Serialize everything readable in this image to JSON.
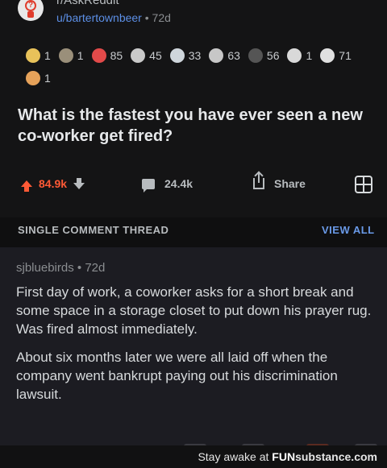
{
  "header": {
    "subreddit": "r/AskReddit",
    "user": "u/bartertownbeer",
    "separator": " • ",
    "age": "72d"
  },
  "awards": [
    {
      "icon": "gold-award-icon",
      "color": "#e8c25a",
      "count": "1"
    },
    {
      "icon": "wholesome-award-icon",
      "color": "#9a8f7a",
      "count": "1"
    },
    {
      "icon": "heart-award-icon",
      "color": "#e24a4a",
      "count": "85"
    },
    {
      "icon": "helpful-award-icon",
      "color": "#c9c9c9",
      "count": "45"
    },
    {
      "icon": "silver-award-icon",
      "color": "#cfd6dc",
      "count": "33"
    },
    {
      "icon": "coin-award-icon",
      "color": "#c7c7c7",
      "count": "63"
    },
    {
      "icon": "badge-award-icon",
      "color": "#555555",
      "count": "56"
    },
    {
      "icon": "face-award-icon",
      "color": "#d9d9d9",
      "count": "1"
    },
    {
      "icon": "bear-award-icon",
      "color": "#e0e0e0",
      "count": "71"
    },
    {
      "icon": "star-award-icon",
      "color": "#e6a25a",
      "count": "1"
    }
  ],
  "post": {
    "title": "What is the fastest you have ever seen a new co-worker get fired?"
  },
  "actions": {
    "votes": "84.9k",
    "comments": "24.4k",
    "share": "Share"
  },
  "thread": {
    "label": "SINGLE COMMENT THREAD",
    "view_all": "VIEW ALL"
  },
  "comment": {
    "user": "sjbluebirds",
    "separator": " • ",
    "age": "72d",
    "paragraphs": [
      "First day of work, a coworker asks for a short break and some space in a storage closet to put down his prayer rug.  Was fired almost immediately.",
      "About six months later we were all laid off when the company went bankrupt paying out his discrimination lawsuit."
    ]
  },
  "footer": {
    "prefix": "Stay awake at ",
    "brand_fun": "FUN",
    "brand_rest": "substance.com"
  },
  "colors": {
    "upvote": "#ff5a36",
    "link": "#5c8fe6",
    "view_all": "#6a9ae8"
  }
}
